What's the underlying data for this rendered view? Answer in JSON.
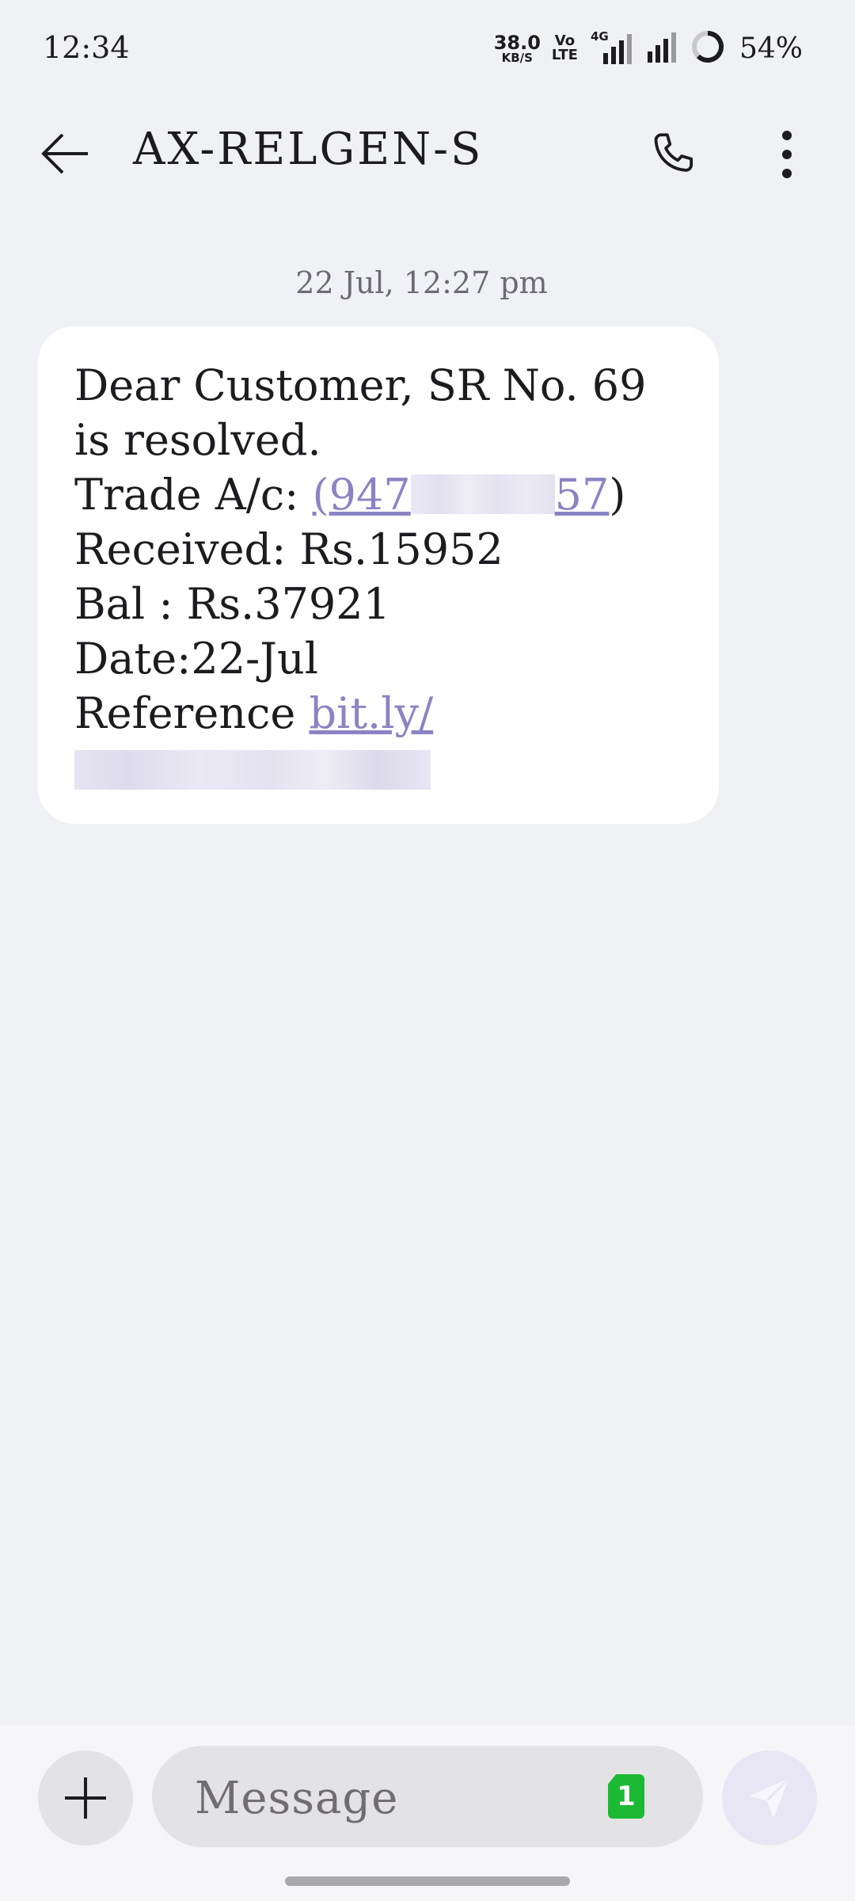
{
  "status_bar": {
    "time": "12:34",
    "net_speed_value": "38.0",
    "net_speed_unit": "KB/S",
    "volte_top": "Vo",
    "volte_bottom": "LTE",
    "network_type": "4G",
    "battery_percent": "54%"
  },
  "header": {
    "contact_name": "AX-RELGEN-S",
    "icons": [
      "back-arrow-icon",
      "phone-icon",
      "more-vert-icon"
    ]
  },
  "conversation": {
    "timestamp": "22 Jul, 12:27 pm",
    "message": {
      "line1": "Dear Customer, SR No. 69",
      "line2": "is resolved.",
      "trade_label": "Trade A/c: ",
      "trade_open": "(",
      "trade_start": "947",
      "trade_end": "57",
      "trade_close": ")",
      "received": "Received: Rs.15952",
      "balance": "Bal : Rs.37921",
      "date": "Date:22-Jul",
      "reference_label": "Reference ",
      "reference_link": "bit.ly/"
    }
  },
  "compose": {
    "placeholder": "Message",
    "sim_number": "1",
    "icons": [
      "plus-icon",
      "send-icon"
    ]
  },
  "colors": {
    "background": "#f0f1f4",
    "bubble": "#ffffff",
    "link": "#8a84c4",
    "sim_badge": "#1bb934",
    "send_button": "#e8e6f4"
  }
}
